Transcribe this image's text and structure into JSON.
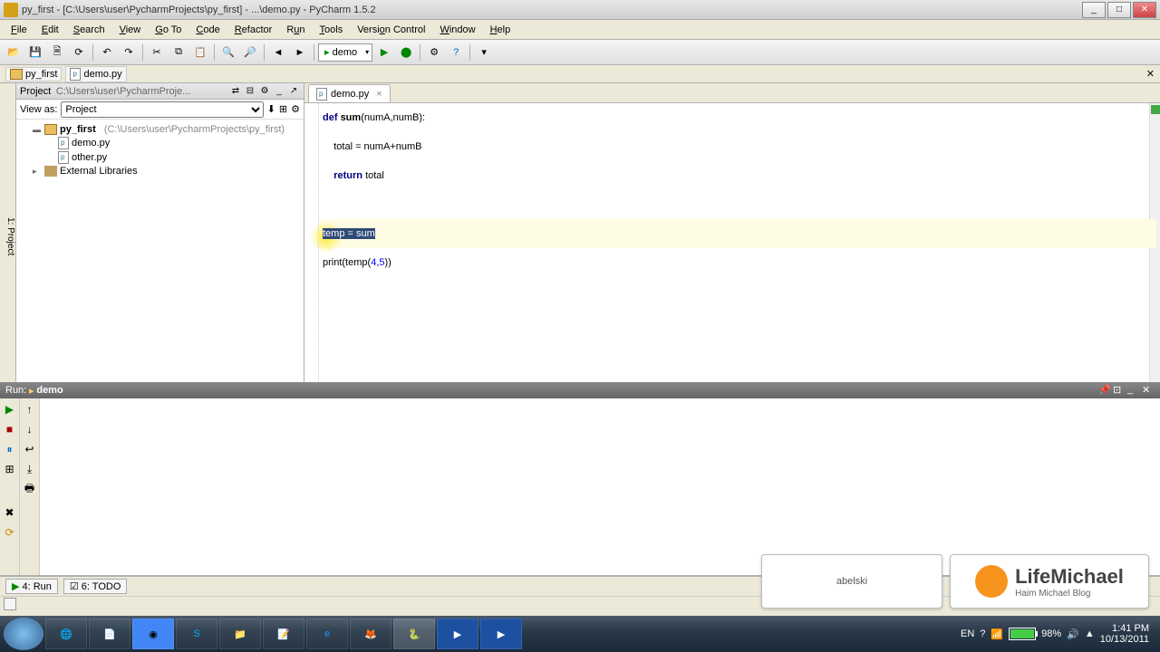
{
  "window": {
    "title": "py_first - [C:\\Users\\user\\PycharmProjects\\py_first] - ...\\demo.py - PyCharm 1.5.2"
  },
  "menu": {
    "items": [
      "File",
      "Edit",
      "Search",
      "View",
      "Go To",
      "Code",
      "Refactor",
      "Run",
      "Tools",
      "Version Control",
      "Window",
      "Help"
    ]
  },
  "toolbar": {
    "runconfig": "demo"
  },
  "breadcrumb": {
    "folder": "py_first",
    "file": "demo.py"
  },
  "project": {
    "header": "Project",
    "path_abbrev": "C:\\Users\\user\\PycharmProje...",
    "viewas_label": "View as:",
    "viewas_value": "Project",
    "root": "py_first",
    "root_path": "(C:\\Users\\user\\PycharmProjects\\py_first)",
    "files": [
      "demo.py",
      "other.py"
    ],
    "libs": "External Libraries"
  },
  "editor": {
    "tab": "demo.py",
    "code": {
      "l1_a": "def ",
      "l1_b": "sum",
      "l1_c": "(numA,numB):",
      "l2": "    total = numA+numB",
      "l3_a": "    ",
      "l3_b": "return",
      "l3_c": " total",
      "l4_sel": "temp = sum",
      "l5_a": "print(temp(",
      "l5_b": "4",
      "l5_c": ",",
      "l5_d": "5",
      "l5_e": "))"
    }
  },
  "run": {
    "header_prefix": "Run:",
    "config": "demo"
  },
  "statusbar": {
    "run": "4: Run",
    "todo": "6: TODO"
  },
  "watermark": {
    "brand1": "abelski",
    "brand2": "LifeMichael",
    "brand2sub": "Haim Michael Blog"
  },
  "taskbar": {
    "lang": "EN",
    "battery": "98%",
    "time": "1:41 PM",
    "date": "10/13/2011"
  }
}
